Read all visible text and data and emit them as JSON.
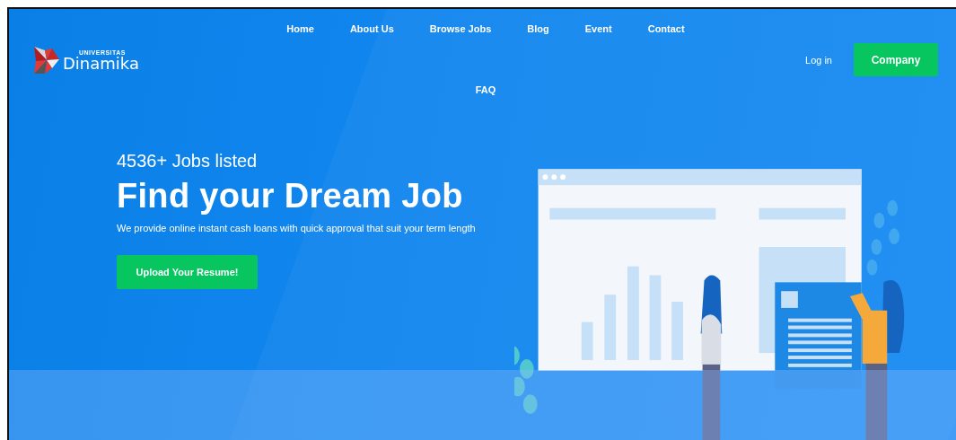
{
  "logo": {
    "small_text": "UNIVERSITAS",
    "name": "Dinamika"
  },
  "nav": [
    "Home",
    "About Us",
    "Browse Jobs",
    "Blog",
    "Event",
    "Contact",
    "FAQ"
  ],
  "login": "Log in",
  "company_button": "Company",
  "hero": {
    "kicker": "4536+ Jobs listed",
    "title": "Find your Dream Job",
    "subtitle": "We provide online instant cash loans with quick approval that suit your term length",
    "button": "Upload Your Resume!"
  }
}
